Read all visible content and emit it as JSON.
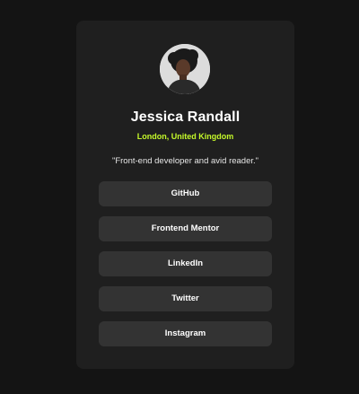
{
  "profile": {
    "name": "Jessica Randall",
    "location": "London, United Kingdom",
    "bio": "\"Front-end developer and avid reader.\""
  },
  "links": [
    {
      "label": "GitHub"
    },
    {
      "label": "Frontend Mentor"
    },
    {
      "label": "LinkedIn"
    },
    {
      "label": "Twitter"
    },
    {
      "label": "Instagram"
    }
  ],
  "colors": {
    "background": "#141414",
    "card": "#1f1f1f",
    "button": "#333333",
    "accent": "#c4f82a",
    "text": "#ffffff"
  }
}
